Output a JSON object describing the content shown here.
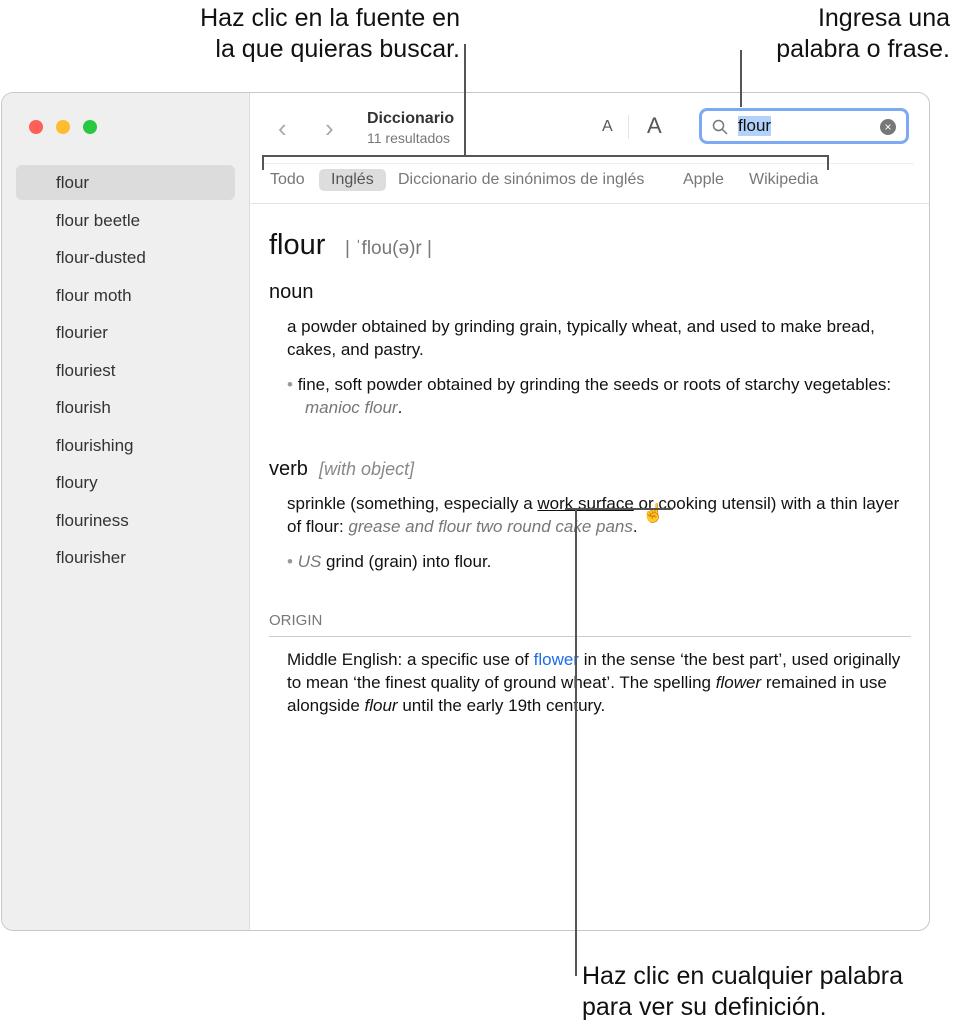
{
  "callouts": {
    "source_1": "Haz clic en la fuente en",
    "source_2": "la que quieras buscar.",
    "search_1": "Ingresa una",
    "search_2": "palabra o frase.",
    "word_1": "Haz clic en cualquier palabra",
    "word_2": "para ver su definición."
  },
  "toolbar": {
    "title": "Diccionario",
    "subtitle": "11 resultados",
    "font_small": "A",
    "font_large": "A"
  },
  "search": {
    "value": "flour",
    "icon": "search-icon"
  },
  "sidebar": {
    "items": [
      "flour",
      "flour beetle",
      "flour-dusted",
      "flour moth",
      "flourier",
      "flouriest",
      "flourish",
      "flourishing",
      "floury",
      "flouriness",
      "flourisher"
    ]
  },
  "tabs": [
    "Todo",
    "Inglés",
    "Diccionario de sinónimos de inglés",
    "Apple",
    "Wikipedia"
  ],
  "entry": {
    "headword": "flour",
    "pron": "| ˈflou(ə)r |",
    "noun": {
      "pos": "noun",
      "def1": "a powder obtained by grinding grain, typically wheat, and used to make bread, cakes, and pastry.",
      "def2": "fine, soft powder obtained by grinding the seeds or roots of starchy vegetables:",
      "ex2": "manioc flour",
      "end2": "."
    },
    "verb": {
      "pos": "verb",
      "gram": "[with object]",
      "d1a": "sprinkle (something, especially a ",
      "d1link": "work surface",
      "d1b": " or cooking utensil) with a thin layer of flour: ",
      "ex1": "grease and flour two round cake pans",
      "end1": ".",
      "reg": "US",
      "d2": " grind (grain) into flour."
    },
    "origin": {
      "label": "ORIGIN",
      "a": "Middle English: a specific use of ",
      "link": "flower",
      "b": " in the sense ‘the best part’, used originally to mean ‘the finest quality of ground wheat’. The spelling ",
      "i1": "flower",
      "c": " remained in use alongside ",
      "i2": "flour",
      "d": " until the early 19th century."
    }
  },
  "colors": {
    "accent": "#1a6ee6",
    "focus": "#7eaaf5",
    "close": "#fe5f57",
    "min": "#febc2e",
    "max": "#28c840"
  }
}
